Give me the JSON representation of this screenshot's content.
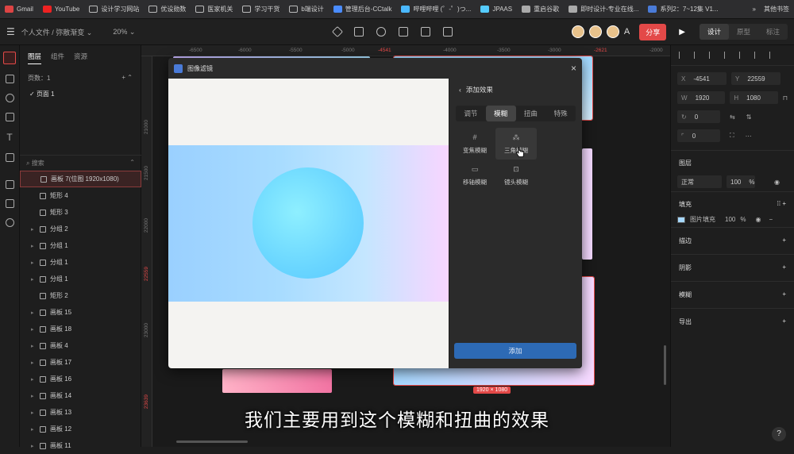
{
  "bookmarks": [
    "Gmail",
    "YouTube",
    "设计学习网站",
    "优设勋数",
    "医家机关",
    "学习干货",
    "b端设计",
    "管理后台-CCtalk",
    "哔哩哔哩 (゜-゜)つ...",
    "JPAAS",
    "重启谷歌",
    "即时设计-专业在线...",
    "系列2：7~12集 V1..."
  ],
  "bookmarks_more": "»",
  "bookmarks_other": "其他书签",
  "toolbar": {
    "breadcrumb": "个人文件 / 弥散渐变 ⌄",
    "zoom": "20% ⌄",
    "share": "分享",
    "modes": [
      "设计",
      "原型",
      "标注"
    ]
  },
  "layers_panel": {
    "tabs": [
      "图层",
      "组件",
      "资源"
    ],
    "pages_label": "页数：1",
    "page1": "页面 1",
    "search_placeholder": "搜索",
    "items": [
      {
        "label": "画板 7(位图 1920x1080)",
        "selected": true
      },
      {
        "label": "矩形 4"
      },
      {
        "label": "矩形 3"
      },
      {
        "label": "分组 2"
      },
      {
        "label": "分组 1"
      },
      {
        "label": "分组 1"
      },
      {
        "label": "分组 1"
      },
      {
        "label": "矩形 2"
      },
      {
        "label": "画板 15"
      },
      {
        "label": "画板 18"
      },
      {
        "label": "画板 4"
      },
      {
        "label": "画板 17"
      },
      {
        "label": "画板 16"
      },
      {
        "label": "画板 14"
      },
      {
        "label": "画板 13"
      },
      {
        "label": "画板 12"
      },
      {
        "label": "画板 11"
      }
    ]
  },
  "ruler_top": [
    "-6500",
    "-6000",
    "-5500",
    "-5000",
    "-4541",
    "-4000",
    "-3500",
    "-3000",
    "-2621",
    "-2000"
  ],
  "ruler_left": [
    "21000",
    "21500",
    "22000",
    "22559",
    "23000",
    "23639"
  ],
  "dimension_label": "1920 × 1080",
  "right_panel": {
    "x_label": "X",
    "x_value": "-4541",
    "y_label": "Y",
    "y_value": "22559",
    "w_label": "W",
    "w_value": "1920",
    "h_label": "H",
    "h_value": "1080",
    "rotation": "0",
    "radius": "0",
    "layer_title": "图层",
    "blend": "正常",
    "opacity": "100",
    "opacity_unit": "%",
    "fill_title": "填充",
    "fill_type": "图片填充",
    "fill_opacity": "100",
    "sections": [
      "描边",
      "阴影",
      "模糊",
      "导出"
    ]
  },
  "dialog": {
    "title": "图像滤镜",
    "close": "×",
    "side_title": "添加效果",
    "tabs": [
      "调节",
      "模糊",
      "扭曲",
      "特殊"
    ],
    "active_tab": 1,
    "effects": [
      {
        "label": "变焦模糊",
        "icon": "#"
      },
      {
        "label": "三角模糊",
        "icon": "⁂"
      },
      {
        "label": "移轴模糊",
        "icon": "▭"
      },
      {
        "label": "镜头模糊",
        "icon": "⊡"
      }
    ],
    "add_button": "添加"
  },
  "subtitle": "我们主要用到这个模糊和扭曲的效果",
  "help": "?"
}
